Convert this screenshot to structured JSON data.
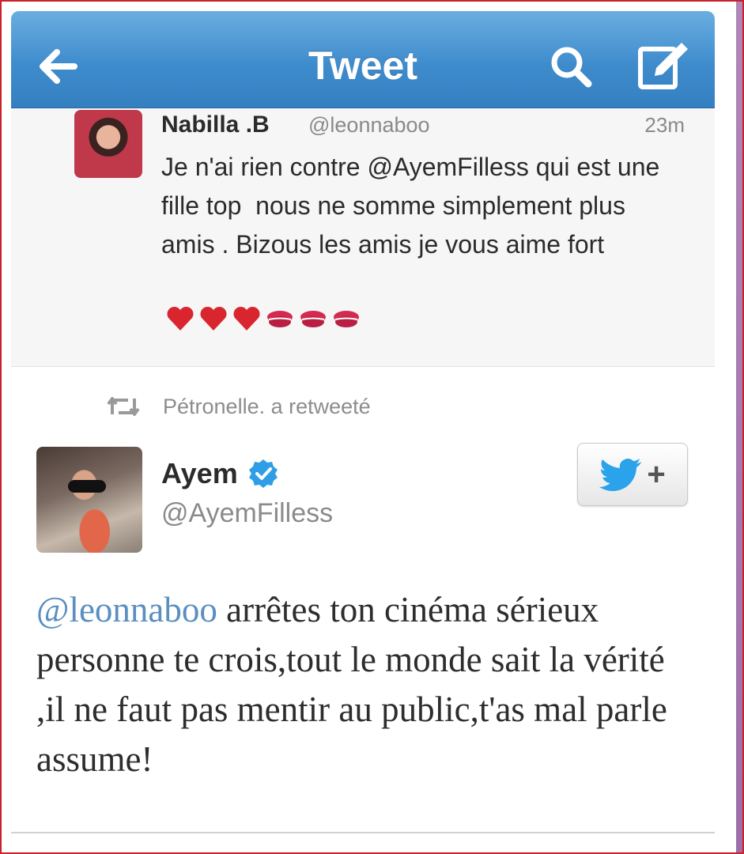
{
  "navbar": {
    "title": "Tweet",
    "back_icon": "arrow-left-icon",
    "search_icon": "search-icon",
    "compose_icon": "compose-icon",
    "color": "#3f8ccd"
  },
  "tweet1": {
    "name": "Nabilla .B",
    "handle": "@leonnaboo",
    "time": "23m",
    "text": "Je n'ai rien contre @AyemFilless qui est une fille top  nous ne somme simplement plus amis . Bizous les amis je vous aime fort",
    "emojis": [
      "heart-emoji",
      "heart-emoji",
      "heart-emoji",
      "kiss-emoji",
      "kiss-emoji",
      "kiss-emoji"
    ]
  },
  "retweet": {
    "text": "Pétronelle. a retweeté",
    "icon": "retweet-icon"
  },
  "tweet2": {
    "name": "Ayem",
    "verified": true,
    "handle": "@AyemFilless",
    "mention": "@leonnaboo",
    "text": " arrêtes ton cinéma sérieux personne te crois,tout le monde sait la vérité ,il ne faut pas mentir au public,t'as mal parle assume!",
    "follow_icon": "bird-plus-icon",
    "follow_plus": "+"
  }
}
